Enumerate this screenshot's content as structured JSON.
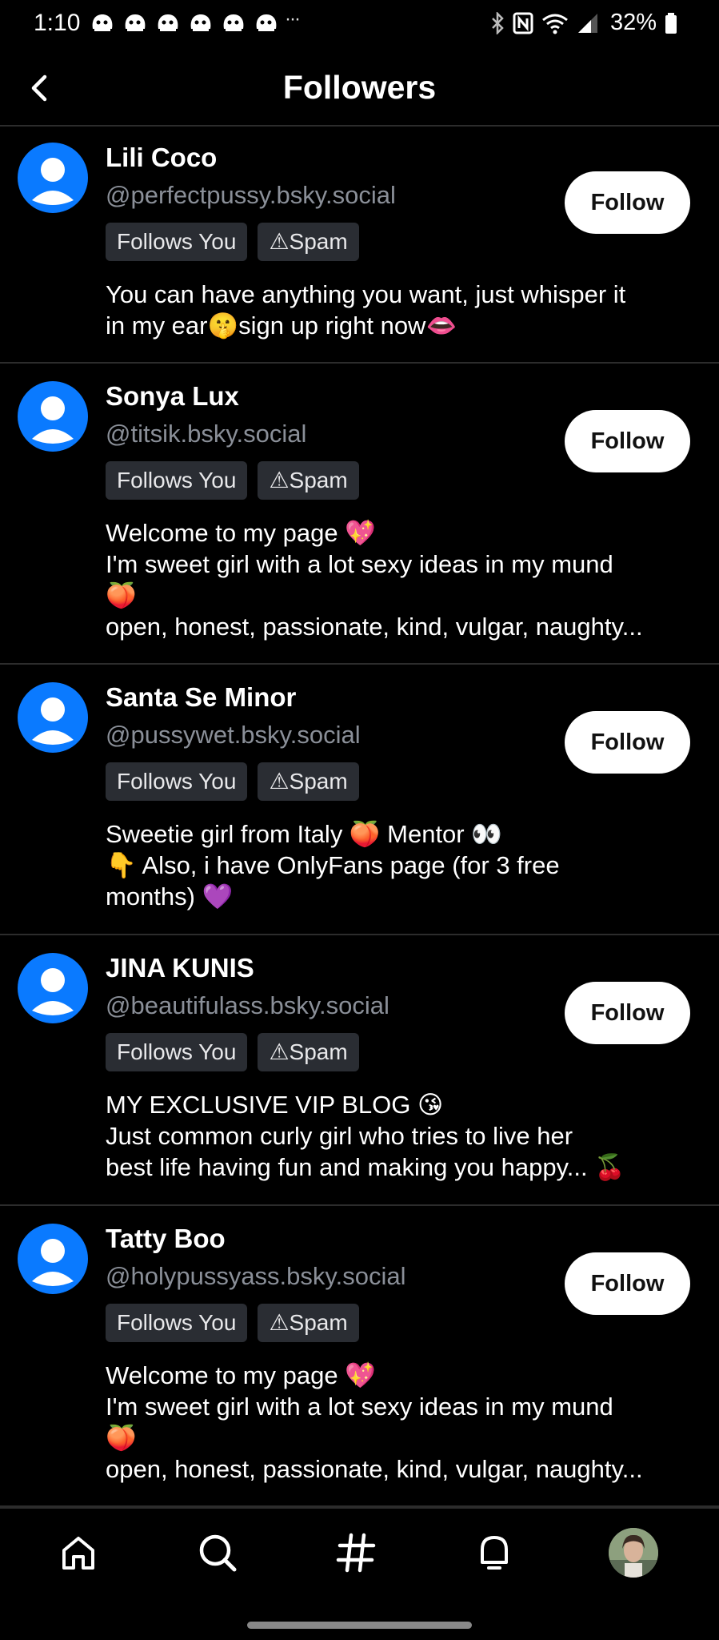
{
  "status_bar": {
    "time": "1:10",
    "more": "···",
    "battery": "32%"
  },
  "header": {
    "title": "Followers"
  },
  "followers": [
    {
      "name": "Lili Coco",
      "handle": "@perfectpussy.bsky.social",
      "badges": [
        "Follows You",
        "⚠Spam"
      ],
      "follow_label": "Follow",
      "bio": [
        "You can have anything you want, just whisper it",
        "in my ear🤫sign up right now👄"
      ]
    },
    {
      "name": "Sonya Lux",
      "handle": "@titsik.bsky.social",
      "badges": [
        "Follows You",
        "⚠Spam"
      ],
      "follow_label": "Follow",
      "bio": [
        "Welcome to my page 💖",
        "I'm sweet girl with a lot sexy ideas in my mund",
        "🍑",
        "open, honest, passionate, kind, vulgar, naughty..."
      ]
    },
    {
      "name": "Santa Se Minor",
      "handle": "@pussywet.bsky.social",
      "badges": [
        "Follows You",
        "⚠Spam"
      ],
      "follow_label": "Follow",
      "bio": [
        "Sweetie girl from Italy 🍑 Mentor 👀",
        "👇 Also, i have OnlyFans page (for 3 free",
        "months) 💜"
      ]
    },
    {
      "name": "JINA KUNIS",
      "handle": "@beautifulass.bsky.social",
      "badges": [
        "Follows You",
        "⚠Spam"
      ],
      "follow_label": "Follow",
      "bio": [
        "MY EXCLUSIVE VIP BLOG 😘",
        "Just common curly girl who tries to live her",
        "best life having fun and making you happy... 🍒"
      ]
    },
    {
      "name": "Tatty Boo",
      "handle": "@holypussyass.bsky.social",
      "badges": [
        "Follows You",
        "⚠Spam"
      ],
      "follow_label": "Follow",
      "bio": [
        "Welcome to my page 💖",
        "I'm sweet girl with a lot sexy ideas in my mund",
        "🍑",
        "open, honest, passionate, kind, vulgar, naughty..."
      ]
    }
  ],
  "bottom_nav": {
    "items": [
      "home-icon",
      "search-icon",
      "hashtag-icon",
      "notifications-icon",
      "profile-avatar"
    ]
  },
  "colors": {
    "background": "#000000",
    "avatar_blue": "#0a7aff",
    "badge_bg": "#2a2d33",
    "handle_gray": "#8a8f98"
  }
}
